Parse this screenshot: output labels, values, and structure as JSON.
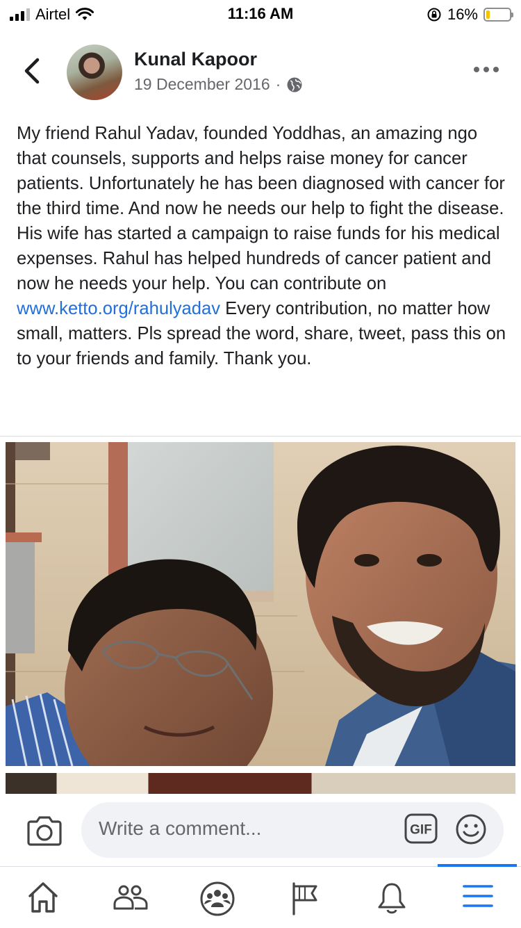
{
  "status_bar": {
    "carrier": "Airtel",
    "time": "11:16 AM",
    "battery_percent": "16%",
    "battery_level": 0.16
  },
  "post": {
    "author": "Kunal Kapoor",
    "date": "19 December 2016",
    "separator": "·",
    "privacy_icon": "globe-icon",
    "text_before_link": "My friend Rahul Yadav, founded Yoddhas, an amazing ngo that counsels, supports and helps raise money for cancer patients. Unfortunately he has been diagnosed with cancer for the third time. And now he needs our help to fight the disease. His wife has started a campaign to raise funds for his medical expenses. Rahul has helped hundreds of cancer patient and now he needs your help. You can contribute on ",
    "link": "www.ketto.org/rahulyadav",
    "text_after_link": " Every contribution, no matter how small, matters. Pls spread the word, share, tweet, pass this on to your friends and family. Thank you."
  },
  "comment_bar": {
    "placeholder": "Write a comment...",
    "gif_label": "GIF"
  },
  "tab_bar": {
    "tabs": [
      {
        "icon": "home-icon"
      },
      {
        "icon": "friends-icon"
      },
      {
        "icon": "groups-icon"
      },
      {
        "icon": "pages-flag-icon"
      },
      {
        "icon": "notifications-bell-icon"
      },
      {
        "icon": "menu-icon",
        "active": true
      }
    ]
  },
  "colors": {
    "link": "#216fdb",
    "active_tab": "#1877f2",
    "secondary_text": "#65676b"
  }
}
